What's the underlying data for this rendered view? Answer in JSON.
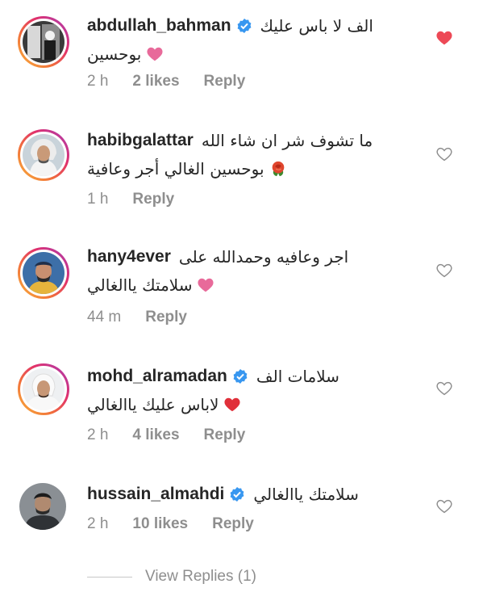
{
  "comments": [
    {
      "username": "abdullah_bahman",
      "verified": true,
      "text": "الف لا باس عليك",
      "second_line": "بوحسين",
      "second_line_emoji": "pink-heart",
      "time": "2 h",
      "likes": "2 likes",
      "reply": "Reply",
      "liked": true,
      "avatar_style": "story-ring"
    },
    {
      "username": "habibgalattar",
      "verified": false,
      "text": "ما تشوف شر ان شاء الله",
      "second_line": "بوحسين الغالي أجر وعافية",
      "second_line_emoji": "rose",
      "time": "1 h",
      "likes": "",
      "reply": "Reply",
      "liked": false,
      "avatar_style": "story-ring"
    },
    {
      "username": "hany4ever",
      "verified": false,
      "text": "اجر وعافيه وحمدالله على",
      "second_line": "سلامتك ياالغالي",
      "second_line_emoji": "pink-heart",
      "time": "44 m",
      "likes": "",
      "reply": "Reply",
      "liked": false,
      "avatar_style": "story-ring"
    },
    {
      "username": "mohd_alramadan",
      "verified": true,
      "text": "سلامات الف",
      "second_line": "لاباس عليك ياالغالي",
      "second_line_emoji": "red-heart",
      "time": "2 h",
      "likes": "4 likes",
      "reply": "Reply",
      "liked": false,
      "avatar_style": "story-ring"
    },
    {
      "username": "hussain_almahdi",
      "verified": true,
      "text": "سلامتك ياالغالي",
      "second_line": "",
      "second_line_emoji": "",
      "time": "2 h",
      "likes": "10 likes",
      "reply": "Reply",
      "liked": false,
      "avatar_style": "plain"
    }
  ],
  "view_replies": "View Replies (1)",
  "colors": {
    "username": "#262626",
    "meta": "#8e8e8e",
    "liked_heart": "#ed4956",
    "pink_heart": "#e86a9a",
    "verified": "#3897f0"
  },
  "icons": {
    "like": "heart-outline-icon",
    "liked": "heart-filled-icon",
    "verified": "verified-badge-icon"
  }
}
